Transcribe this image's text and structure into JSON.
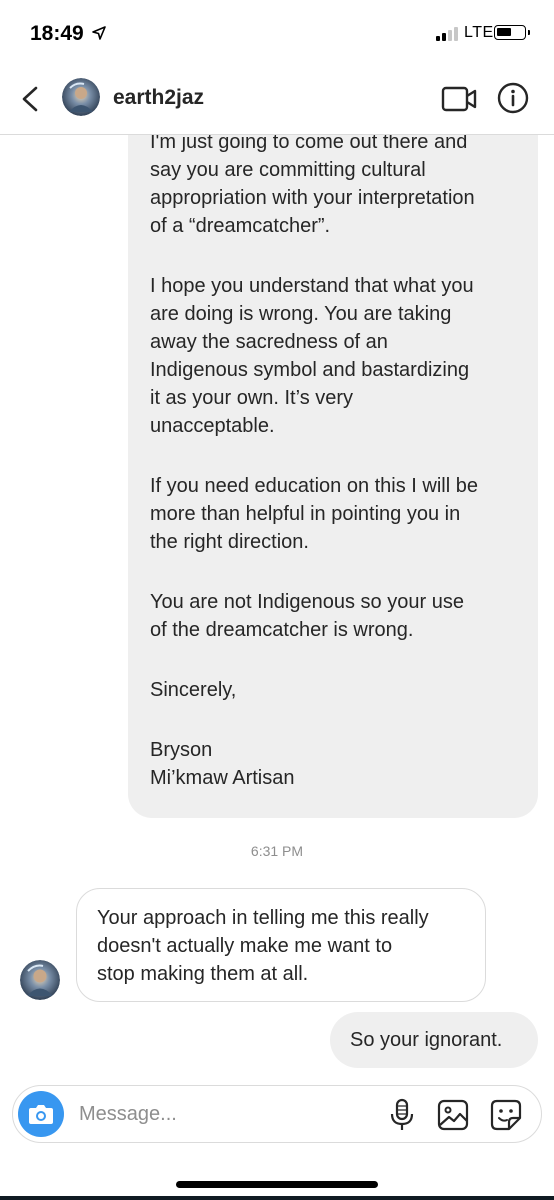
{
  "status_bar": {
    "time": "18:49",
    "network": "LTE",
    "icons": [
      "location-arrow-icon",
      "signal-bars-icon",
      "battery-icon"
    ]
  },
  "header": {
    "username": "earth2jaz",
    "back_icon": "chevron-left-icon",
    "actions": [
      "video-call-icon",
      "info-icon"
    ]
  },
  "thread": {
    "received_long": {
      "paragraphs": [
        "I'm just going to come out there and\nsay you are committing cultural\nappropriation with your interpretation\nof a “dreamcatcher”.",
        "I hope you understand that what you\nare doing is wrong. You are taking\naway the sacredness of an\nIndigenous symbol and bastardizing\nit as your own. It’s very\nunacceptable.",
        "If you need education on this I will be\nmore than helpful in pointing you in\nthe right direction.",
        "You are not Indigenous so your use\nof the dreamcatcher is wrong.",
        "Sincerely,",
        "Bryson\nMi’kmaw Artisan"
      ]
    },
    "timestamp": "6:31 PM",
    "incoming_reply": "Your approach in telling me this really\ndoesn't actually make me want to\nstop making them at all.",
    "outgoing_reply": "So your ignorant."
  },
  "composer": {
    "placeholder": "Message...",
    "value": "",
    "icons": [
      "camera-icon",
      "microphone-icon",
      "gallery-icon",
      "sticker-icon"
    ]
  },
  "colors": {
    "accent_blue": "#3897f0",
    "bubble_gray": "#efefef",
    "border_gray": "#dbdbdb",
    "text_primary": "#262626",
    "text_secondary": "#8e8e8e"
  }
}
